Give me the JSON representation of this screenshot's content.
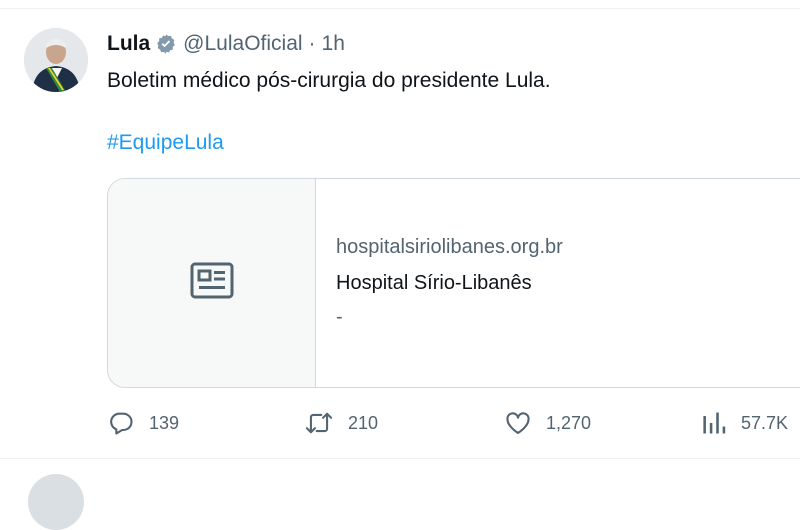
{
  "tweet": {
    "author_name": "Lula",
    "author_handle": "@LulaOficial",
    "separator": "·",
    "time": "1h",
    "text": "Boletim médico pós-cirurgia do presidente Lula.",
    "hashtag": "#EquipeLula",
    "verified_color": "#829aab",
    "link_color": "#1d9bf0"
  },
  "card": {
    "domain": "hospitalsiriolibanes.org.br",
    "title": "Hospital Sírio-Libanês",
    "description": "-",
    "media_icon": "article-icon"
  },
  "actions": {
    "replies": "139",
    "retweets": "210",
    "likes": "1,270",
    "views": "57.7K"
  }
}
